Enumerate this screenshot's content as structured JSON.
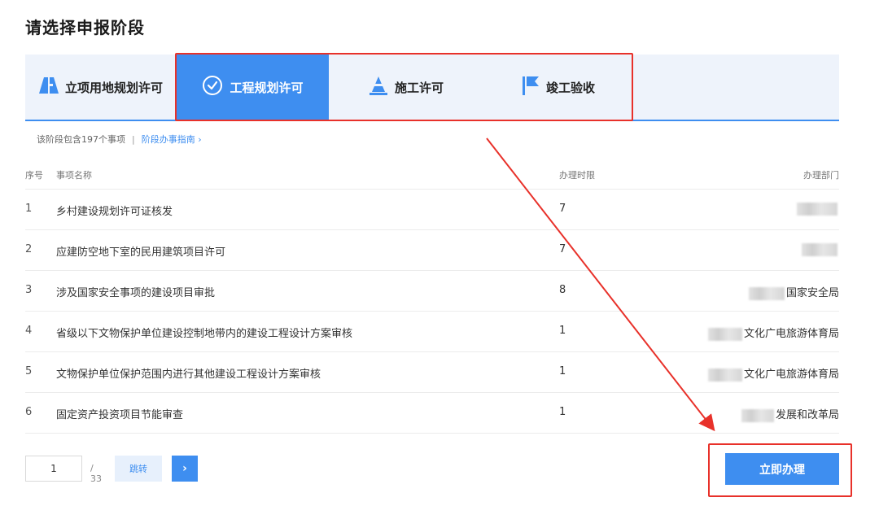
{
  "page": {
    "title": "请选择申报阶段"
  },
  "tabs": [
    {
      "label": "立项用地规划许可",
      "icon": "building-icon",
      "active": false
    },
    {
      "label": "工程规划许可",
      "icon": "check-circle-icon",
      "active": true
    },
    {
      "label": "施工许可",
      "icon": "cone-icon",
      "active": false
    },
    {
      "label": "竣工验收",
      "icon": "flag-icon",
      "active": false
    }
  ],
  "info": {
    "count_text": "该阶段包含197个事项",
    "separator": "|",
    "guide_link": "阶段办事指南 ›"
  },
  "table": {
    "headers": {
      "index": "序号",
      "name": "事项名称",
      "limit": "办理时限",
      "dept": "办理部门"
    },
    "rows": [
      {
        "index": "1",
        "name": "乡村建设规划许可证核发",
        "limit": "7",
        "dept": ""
      },
      {
        "index": "2",
        "name": "应建防空地下室的民用建筑项目许可",
        "limit": "7",
        "dept": ""
      },
      {
        "index": "3",
        "name": "涉及国家安全事项的建设项目审批",
        "limit": "8",
        "dept": "国家安全局"
      },
      {
        "index": "4",
        "name": "省级以下文物保护单位建设控制地带内的建设工程设计方案审核",
        "limit": "1",
        "dept": "文化广电旅游体育局"
      },
      {
        "index": "5",
        "name": "文物保护单位保护范围内进行其他建设工程设计方案审核",
        "limit": "1",
        "dept": "文化广电旅游体育局"
      },
      {
        "index": "6",
        "name": "固定资产投资项目节能审查",
        "limit": "1",
        "dept": "发展和改革局"
      }
    ]
  },
  "pager": {
    "current": "1",
    "total": "/ 33",
    "jump_label": "跳转",
    "next_icon": "chevron-right-icon",
    "next_glyph": "›"
  },
  "action": {
    "label": "立即办理"
  },
  "colors": {
    "accent": "#3e8ef0",
    "highlight": "#e8312a",
    "tab_band": "#eef3fb"
  }
}
